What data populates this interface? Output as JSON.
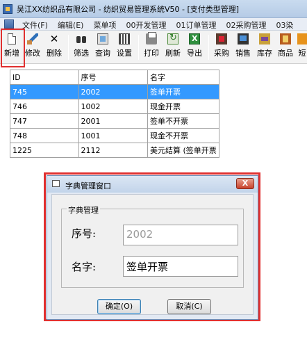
{
  "window": {
    "title": "吴江XX纺织品有限公司 - 纺织贸易管理系统V50 - [支付类型管理]"
  },
  "menubar": {
    "items": [
      "文件(F)",
      "编辑(E)",
      "菜单项",
      "00开发管理",
      "01订单管理",
      "02采购管理",
      "03染"
    ]
  },
  "toolbar": {
    "buttons": [
      {
        "label": "新增",
        "icon": "new-document-icon"
      },
      {
        "label": "修改",
        "icon": "edit-brush-icon"
      },
      {
        "label": "删除",
        "icon": "delete-x-icon"
      },
      {
        "label": "筛选",
        "icon": "binoculars-icon"
      },
      {
        "label": "查询",
        "icon": "query-icon"
      },
      {
        "label": "设置",
        "icon": "settings-grid-icon"
      },
      {
        "label": "打印",
        "icon": "printer-icon"
      },
      {
        "label": "刷新",
        "icon": "refresh-icon"
      },
      {
        "label": "导出",
        "icon": "excel-export-icon"
      },
      {
        "label": "采购",
        "icon": "purchase-icon"
      },
      {
        "label": "销售",
        "icon": "sales-icon"
      },
      {
        "label": "库存",
        "icon": "inventory-icon"
      },
      {
        "label": "商品",
        "icon": "goods-icon"
      },
      {
        "label": "短",
        "icon": "sms-icon"
      }
    ]
  },
  "grid": {
    "columns": [
      "ID",
      "序号",
      "名字"
    ],
    "rows": [
      [
        "745",
        "2002",
        "签单开票"
      ],
      [
        "746",
        "1002",
        "现金开票"
      ],
      [
        "747",
        "2001",
        "签单不开票"
      ],
      [
        "748",
        "1001",
        "现金不开票"
      ],
      [
        "1225",
        "2112",
        "美元结算 (签单开票"
      ]
    ],
    "selected_row": 0
  },
  "dialog": {
    "title": "字典管理窗口",
    "close_label": "X",
    "group_title": "字典管理",
    "seq_label": "序号:",
    "seq_value": "2002",
    "name_label": "名字:",
    "name_value": "签单开票",
    "ok_label": "确定(O)",
    "cancel_label": "取消(C)"
  },
  "colors": {
    "highlight": "#e03030",
    "selection": "#3399ff"
  }
}
